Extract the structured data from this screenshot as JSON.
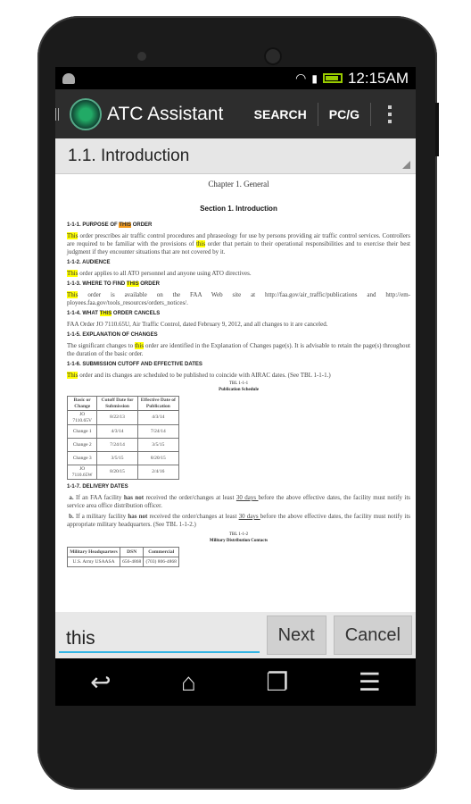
{
  "status": {
    "time": "12:15AM"
  },
  "app": {
    "title": "ATC Assistant",
    "search": "SEARCH",
    "pcg": "PC/G"
  },
  "section_title": "1.1. Introduction",
  "doc": {
    "chapter": "Chapter 1. General",
    "section": "Section 1. Introduction",
    "h1": {
      "pre": "1-1-1. PURPOSE OF ",
      "hl": "THIS",
      "post": " ORDER"
    },
    "p1": {
      "hl1": "This",
      "a": " order prescribes air traffic control procedures and phraseology for use by persons providing air traffic control services. Controllers are required to be familiar with the provisions of ",
      "hl2": "this",
      "b": " order that pertain to their operational responsibilities and to exercise their best judgment if they encounter situations that are not covered by it."
    },
    "h2": "1-1-2. AUDIENCE",
    "p2": {
      "hl": "This",
      "post": " order applies to all ATO personnel and anyone using ATO directives."
    },
    "h3": {
      "pre": "1-1-3. WHERE TO FIND ",
      "hl": "THIS",
      "post": " ORDER"
    },
    "p3": {
      "hl": "This",
      "post": " order is available on the FAA Web site at http://faa.gov/air_traffic/publications and http://em-ployees.faa.gov/tools_resources/orders_notices/."
    },
    "h4": {
      "pre": "1-1-4. WHAT ",
      "hl": "THIS",
      "post": " ORDER CANCELS"
    },
    "p4": "FAA Order JO 7110.65U, Air Traffic Control, dated February 9, 2012, and all changes to it are canceled.",
    "h5": "1-1-5. EXPLANATION OF CHANGES",
    "p5": {
      "pre": "The significant changes to ",
      "hl": "this",
      "post": " order are identified in the Explanation of Changes page(s). It is advisable to retain the page(s) throughout the duration of the basic order."
    },
    "h6": "1-1-6. SUBMISSION CUTOFF AND EFFECTIVE DATES",
    "p6": {
      "hl": "This",
      "post": " order and its changes are scheduled to be published to coincide with AIRAC dates. (See TBL 1-1-1.)"
    },
    "tbl1": {
      "num": "TBL 1-1-1",
      "title": "Publication Schedule",
      "headers": [
        "Basic or Change",
        "Cutoff Date for Submission",
        "Effective Date of Publication"
      ],
      "rows": [
        [
          "JO 7110.65V",
          "8/22/13",
          "4/3/14"
        ],
        [
          "Change 1",
          "4/3/14",
          "7/24/14"
        ],
        [
          "Change 2",
          "7/24/14",
          "3/5/15"
        ],
        [
          "Change 3",
          "3/5/15",
          "8/20/15"
        ],
        [
          "JO 7110.65W",
          "8/20/15",
          "2/4/16"
        ]
      ]
    },
    "h7": "1-1-7. DELIVERY DATES",
    "pa": {
      "a": "a.",
      "t1": " If an FAA facility ",
      "b": "has not",
      "t2": " received the order/changes at least ",
      "u": "30 days ",
      "t3": "before the above effective dates, the facility must notify its service area office distribution officer."
    },
    "pb": {
      "a": "b.",
      "t1": " If a military facility ",
      "b": "has not",
      "t2": " received the order/changes at least ",
      "u": "30 days ",
      "t3": "before the above effective dates, the facility must notify its appropriate military headquarters. (See TBL 1-1-2.)"
    },
    "tbl2": {
      "num": "TBL 1-1-2",
      "title": "Military Distribution Contacts",
      "headers": [
        "Military Headquarters",
        "DSN",
        "Commercial"
      ],
      "rows": [
        [
          "U.S. Army USAASA",
          "656-4868",
          "(703) 806-4868"
        ]
      ]
    }
  },
  "find": {
    "value": "this",
    "next": "Next",
    "cancel": "Cancel"
  }
}
